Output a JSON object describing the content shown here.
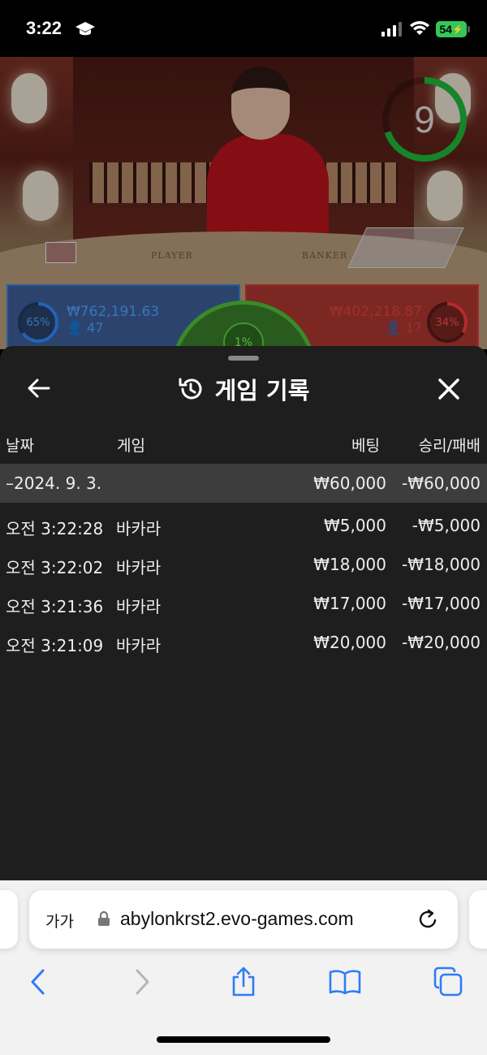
{
  "status_bar": {
    "time": "3:22",
    "battery": "54"
  },
  "game": {
    "timer": "9",
    "player": {
      "percent": "65%",
      "amount": "₩762,191.63",
      "players": "47"
    },
    "banker": {
      "percent": "34%",
      "amount": "₩402,218.87",
      "players": "17"
    },
    "tie": {
      "percent": "1%"
    },
    "table_labels": [
      "PLAYER",
      "BANKER"
    ]
  },
  "history": {
    "title": "게임 기록",
    "columns": {
      "date": "날짜",
      "game": "게임",
      "bet": "베팅",
      "result": "승리/패배"
    },
    "summary": {
      "date": "–2024. 9. 3.",
      "bet": "₩60,000",
      "result": "-₩60,000"
    },
    "rows": [
      {
        "time": "오전 3:22:28",
        "game": "바카라",
        "bet": "₩5,000",
        "result": "-₩5,000"
      },
      {
        "time": "오전 3:22:02",
        "game": "바카라",
        "bet": "₩18,000",
        "result": "-₩18,000"
      },
      {
        "time": "오전 3:21:36",
        "game": "바카라",
        "bet": "₩17,000",
        "result": "-₩17,000"
      },
      {
        "time": "오전 3:21:09",
        "game": "바카라",
        "bet": "₩20,000",
        "result": "-₩20,000"
      }
    ]
  },
  "browser": {
    "text_size": "가가",
    "url": "abylonkrst2.evo-games.com"
  },
  "colors": {
    "accent": "#2f7cf6",
    "player": "#4ea3ff",
    "banker": "#ff4d4d",
    "tie": "#4fbf3a"
  }
}
